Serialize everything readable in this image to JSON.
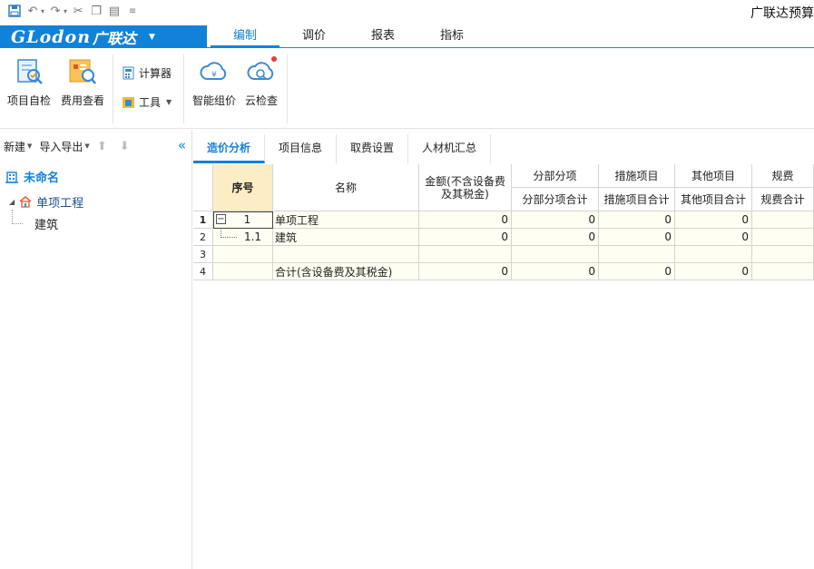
{
  "title_bar": {
    "app_title": "广联达预算"
  },
  "brand": {
    "logo_text": "GLodon",
    "name": "广联达",
    "accent": "#1282d8"
  },
  "menu_tabs": [
    "编制",
    "调价",
    "报表",
    "指标"
  ],
  "ribbon": {
    "buttons": [
      {
        "label": "项目自检",
        "icon": "project-check-icon"
      },
      {
        "label": "费用查看",
        "icon": "cost-view-icon"
      },
      {
        "label": "智能组价",
        "icon": "smart-pricing-icon"
      },
      {
        "label": "云检查",
        "icon": "cloud-check-icon"
      }
    ],
    "small": {
      "calculator": "计算器",
      "tools": "工具"
    }
  },
  "left_panel": {
    "new_label": "新建",
    "import_export_label": "导入导出",
    "tree": {
      "root": "未命名",
      "node1": "单项工程",
      "node2": "建筑"
    }
  },
  "content_tabs": [
    "造价分析",
    "项目信息",
    "取费设置",
    "人材机汇总"
  ],
  "grid": {
    "headers": {
      "seq": "序号",
      "name": "名称",
      "amount": "金额(不含设备费及其税金)",
      "fbfx": "分部分项",
      "fbfx_total": "分部分项合计",
      "csxm": "措施项目",
      "csxm_total": "措施项目合计",
      "qtxm": "其他项目",
      "qtxm_total": "其他项目合计",
      "gf": "规费",
      "gf_total": "规费合计"
    },
    "rows": [
      {
        "rn": "1",
        "seq": "1",
        "name": "单项工程",
        "amount": "0",
        "fbfx": "0",
        "csxm": "0",
        "qtxm": "0",
        "gf": ""
      },
      {
        "rn": "2",
        "seq": "1.1",
        "name": "建筑",
        "amount": "0",
        "fbfx": "0",
        "csxm": "0",
        "qtxm": "0",
        "gf": ""
      },
      {
        "rn": "3",
        "seq": "",
        "name": "",
        "amount": "",
        "fbfx": "",
        "csxm": "",
        "qtxm": "",
        "gf": ""
      },
      {
        "rn": "4",
        "seq": "",
        "name": "合计(含设备费及其税金)",
        "amount": "0",
        "fbfx": "0",
        "csxm": "0",
        "qtxm": "0",
        "gf": ""
      }
    ]
  }
}
